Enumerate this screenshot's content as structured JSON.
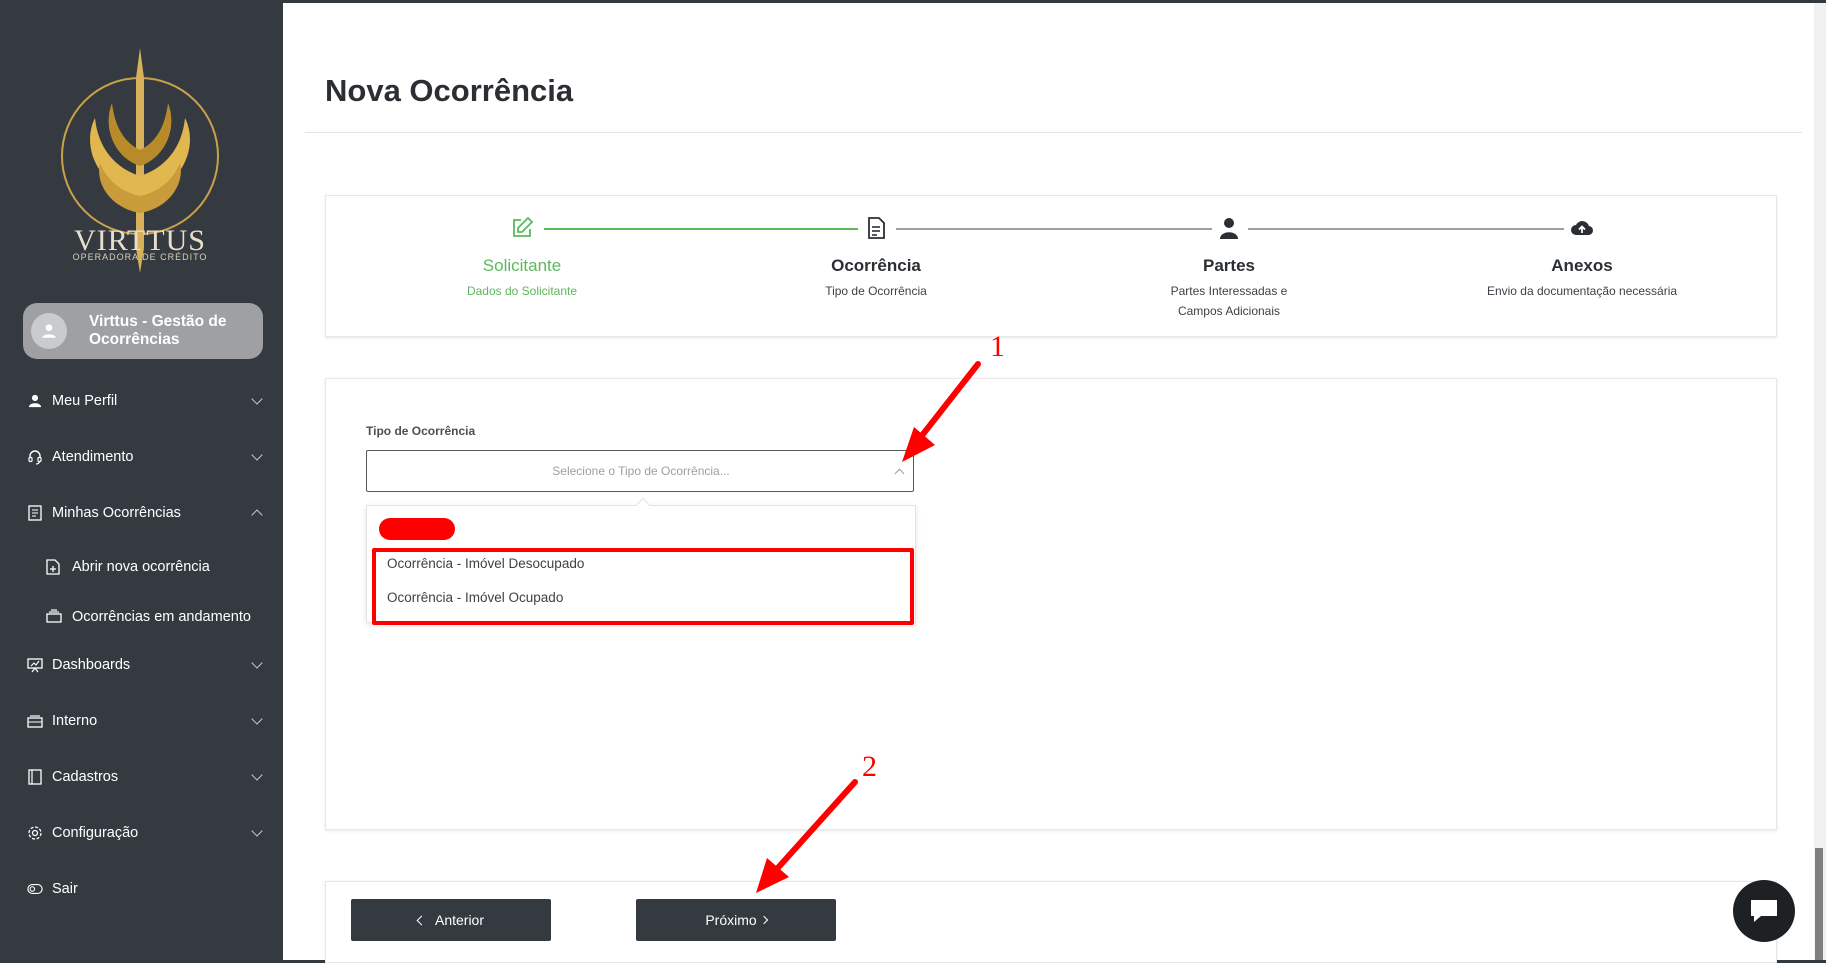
{
  "sidebar": {
    "logo_text": "VIRTTUS",
    "logo_sub": "OPERADORA DE CRÉDITO",
    "user_name": "Virttus - Gestão de Ocorrências",
    "items": [
      {
        "label": "Meu Perfil",
        "icon": "user-icon"
      },
      {
        "label": "Atendimento",
        "icon": "headset-icon"
      },
      {
        "label": "Minhas Ocorrências",
        "icon": "document-icon"
      },
      {
        "label": "Abrir nova ocorrência",
        "icon": "file-plus-icon"
      },
      {
        "label": "Ocorrências em andamento",
        "icon": "stack-icon"
      },
      {
        "label": "Dashboards",
        "icon": "presentation-icon"
      },
      {
        "label": "Interno",
        "icon": "archive-icon"
      },
      {
        "label": "Cadastros",
        "icon": "book-icon"
      },
      {
        "label": "Configuração",
        "icon": "gear-icon"
      },
      {
        "label": "Sair",
        "icon": "toggle-icon"
      }
    ]
  },
  "main": {
    "page_title": "Nova Ocorrência",
    "steps": [
      {
        "title": "Solicitante",
        "subtitle": "Dados do Solicitante",
        "icon": "edit-icon",
        "state": "done"
      },
      {
        "title": "Ocorrência",
        "subtitle": "Tipo de Ocorrência",
        "icon": "file-text-icon",
        "state": "current"
      },
      {
        "title": "Partes",
        "subtitle": "Partes Interessadas e Campos Adicionais",
        "icon": "person-icon",
        "state": "todo"
      },
      {
        "title": "Anexos",
        "subtitle": "Envio da documentação necessária",
        "icon": "cloud-upload-icon",
        "state": "todo"
      }
    ],
    "form": {
      "field_label": "Tipo de Ocorrência",
      "select_placeholder": "Selecione o Tipo de Ocorrência...",
      "options": [
        "Ocorrência - Imóvel Desocupado",
        "Ocorrência - Imóvel Ocupado"
      ]
    },
    "buttons": {
      "prev": "Anterior",
      "next": "Próximo"
    }
  },
  "annotations": {
    "one": "1",
    "two": "2"
  },
  "colors": {
    "sidebar": "#343a40",
    "success": "#5cb85c",
    "annotation": "#ff0000"
  }
}
